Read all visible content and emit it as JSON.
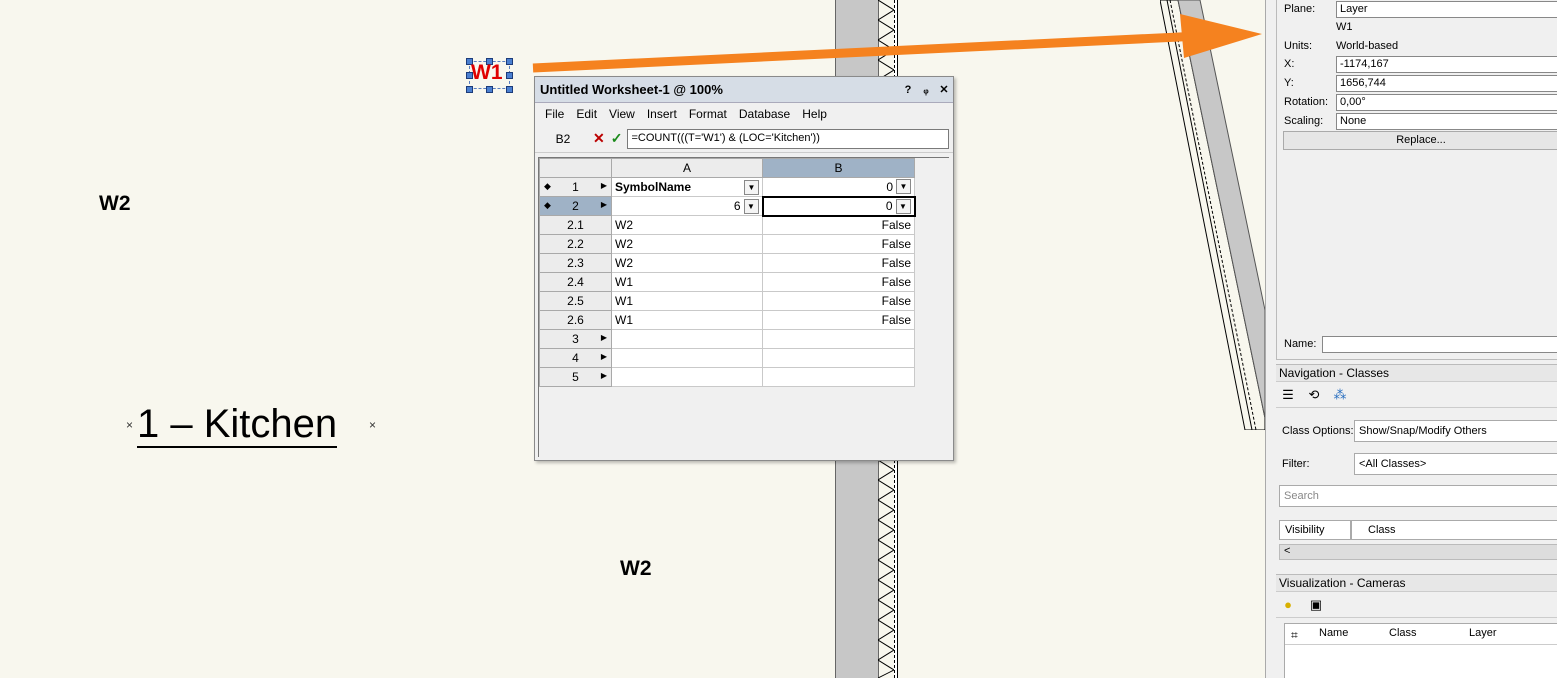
{
  "canvas": {
    "tags": {
      "w1": "W1",
      "w2_left": "W2",
      "w2_bottom": "W2"
    },
    "room_label": "1 – Kitchen",
    "room_mark": "×"
  },
  "worksheet": {
    "title": "Untitled Worksheet-1 @ 100%",
    "title_buttons": {
      "help": "?",
      "pin": "ᵩ",
      "close": "✕"
    },
    "menu": [
      "File",
      "Edit",
      "View",
      "Insert",
      "Format",
      "Database",
      "Help"
    ],
    "cell_ref": "B2",
    "formula": "=COUNT(((T='W1') & (LOC='Kitchen'))",
    "columns": [
      "A",
      "B"
    ],
    "rows": [
      {
        "head": "1",
        "a": "SymbolName",
        "b": "0"
      },
      {
        "head": "2",
        "a": "6",
        "b": "0"
      },
      {
        "head": "2.1",
        "a": "W2",
        "b": "False"
      },
      {
        "head": "2.2",
        "a": "W2",
        "b": "False"
      },
      {
        "head": "2.3",
        "a": "W2",
        "b": "False"
      },
      {
        "head": "2.4",
        "a": "W1",
        "b": "False"
      },
      {
        "head": "2.5",
        "a": "W1",
        "b": "False"
      },
      {
        "head": "2.6",
        "a": "W1",
        "b": "False"
      },
      {
        "head": "3",
        "a": "",
        "b": ""
      },
      {
        "head": "4",
        "a": "",
        "b": ""
      },
      {
        "head": "5",
        "a": "",
        "b": ""
      }
    ]
  },
  "object_info": {
    "plane_label": "Plane:",
    "plane_value": "Layer",
    "symbol": "W1",
    "units_label": "Units:",
    "units_value": "World-based",
    "x_label": "X:",
    "x_value": "-1174,167",
    "y_label": "Y:",
    "y_value": "1656,744",
    "rotation_label": "Rotation:",
    "rotation_value": "0,00°",
    "scaling_label": "Scaling:",
    "scaling_value": "None",
    "replace_label": "Replace...",
    "name_label": "Name:"
  },
  "nav_classes": {
    "title": "Navigation - Classes",
    "class_options_label": "Class Options:",
    "class_options_value": "Show/Snap/Modify Others",
    "filter_label": "Filter:",
    "filter_value": "<All Classes>",
    "search_placeholder": "Search",
    "col_visibility": "Visibility",
    "col_class": "Class",
    "scroll_left": "<"
  },
  "viz_cameras": {
    "title": "Visualization - Cameras",
    "col_name": "Name",
    "col_class": "Class",
    "col_layer": "Layer"
  },
  "colors": {
    "arrow": "#f5821f",
    "selection": "#4a7fd0",
    "header_selected": "#9fb2c6"
  }
}
